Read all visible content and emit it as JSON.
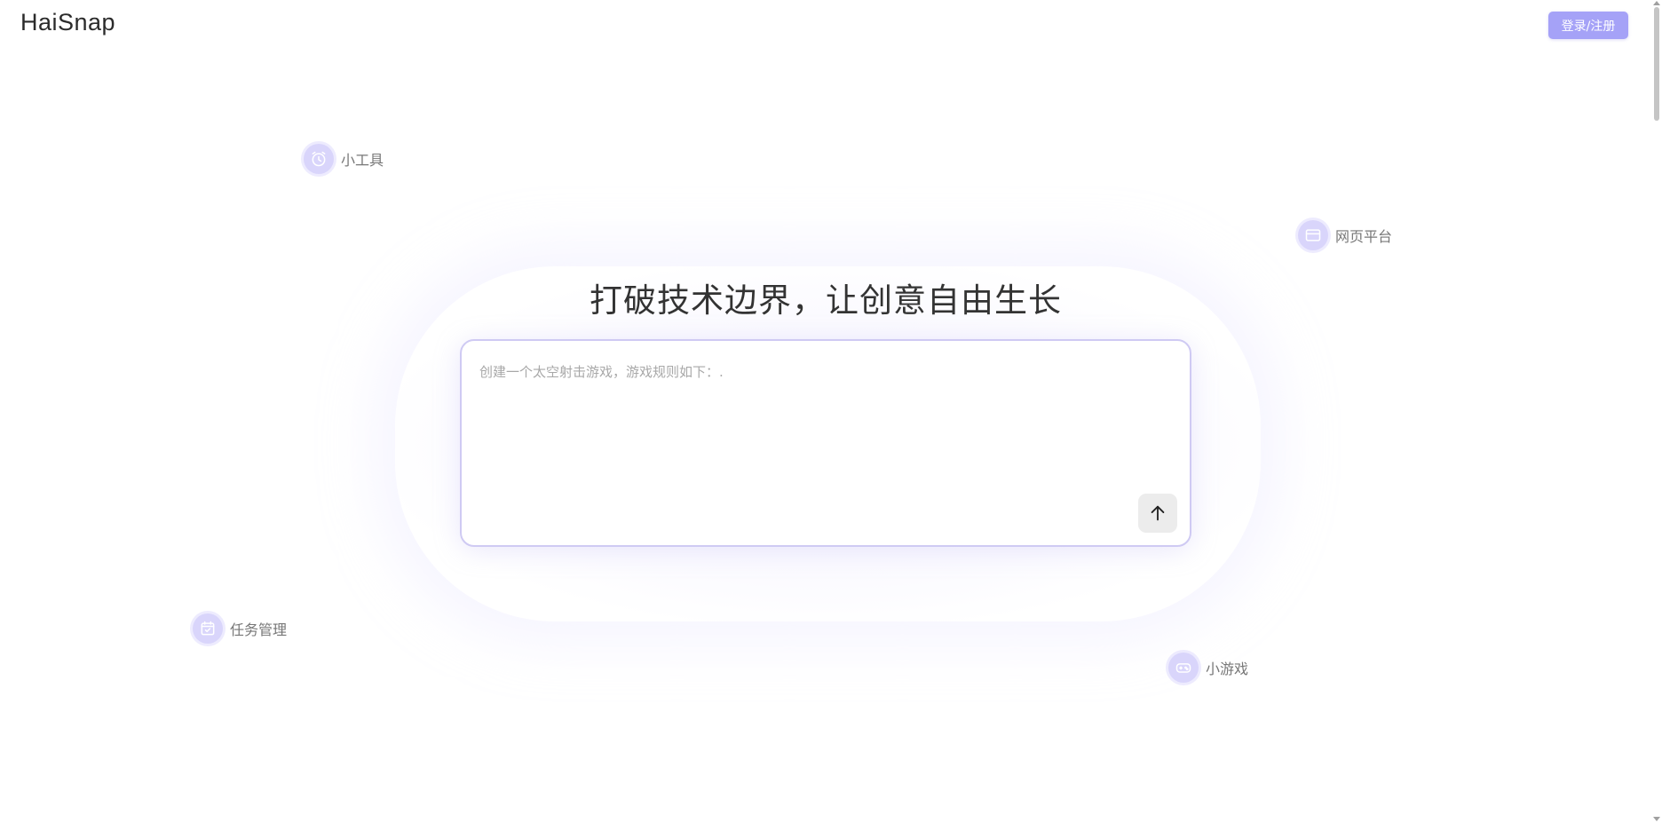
{
  "header": {
    "logo": "HaiSnap",
    "login_label": "登录/注册"
  },
  "hero": {
    "headline": "打破技术边界，让创意自由生长",
    "prompt_placeholder": "创建一个太空射击游戏，游戏规则如下：.",
    "send_icon": "arrow-up-icon"
  },
  "tags": [
    {
      "label": "小工具",
      "icon": "clock-icon"
    },
    {
      "label": "网页平台",
      "icon": "browser-window-icon"
    },
    {
      "label": "任务管理",
      "icon": "calendar-check-icon"
    },
    {
      "label": "小游戏",
      "icon": "gamepad-icon"
    }
  ],
  "colors": {
    "accent": "#a5a2f7",
    "icon_bg": "#d9d5fb",
    "icon_stroke": "#ffffff",
    "headline": "#333333"
  }
}
